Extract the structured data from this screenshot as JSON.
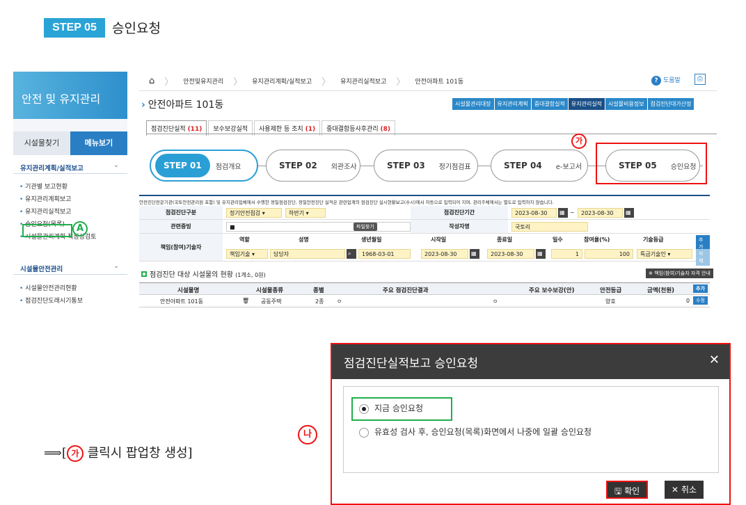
{
  "heading": {
    "step_badge": "STEP 05",
    "title": "승인요청"
  },
  "sidebar": {
    "title": "안전 및 유지관리",
    "tabs": [
      "시설물찾기",
      "메뉴보기"
    ],
    "section1": "유지관리계획/실적보고",
    "items1": [
      "기관별 보고현황",
      "유지관리계획보고",
      "유지관리실적보고",
      "승인요청(목록)",
      "시설물관리계획 적정성검토"
    ],
    "section2": "시설물안전관리",
    "items2": [
      "시설물안전관리현황",
      "점검진단도래시기통보"
    ],
    "marker": "A"
  },
  "breadcrumb": [
    "안전및유지관리",
    "유지관리계획/실적보고",
    "유지관리실적보고",
    "안전아파트 101동"
  ],
  "help_label": "도움말",
  "page_title": "안전아파트 101동",
  "topnav": [
    "시설물관리대장",
    "유지관리계획",
    "중대결함실적",
    "유지관리실적",
    "시설물비용정보",
    "점검진단대가산정"
  ],
  "subtabs": [
    {
      "label": "점검진단실적",
      "count": "(11)"
    },
    {
      "label": "보수보강실적",
      "count": ""
    },
    {
      "label": "사용제한 등 조치",
      "count": "(1)"
    },
    {
      "label": "중대결함등사후관리",
      "count": "(8)"
    }
  ],
  "steps": [
    {
      "id": "STEP 01",
      "name": "점검개요"
    },
    {
      "id": "STEP 02",
      "name": "외관조사"
    },
    {
      "id": "STEP 03",
      "name": "정기점검표"
    },
    {
      "id": "STEP 04",
      "name": "e-보고서"
    },
    {
      "id": "STEP 05",
      "name": "승인요청"
    }
  ],
  "marker_ga": "가",
  "marker_na": "나",
  "notice": "안전진단전문기관(국토안전관리원 포함) 및 유지관리업체에서 수행한 정밀점검진단, 정밀안전진단 실적은 관련업계의 점검진단 실시현황보고(수시)에서 자동으로 입력되어 지며, 관리주체에서는 별도로 입력하지 않습니다.",
  "form": {
    "type_label": "점검진단구분",
    "type_val": "정기안전점검",
    "half_val": "하반기",
    "period_label": "점검진단기간",
    "start": "2023-08-30",
    "end": "2023-08-30",
    "evidence_label": "관련증빙",
    "file_btn": "파일찾기",
    "writer_label": "작성자명",
    "writer": "국토리",
    "eng_label": "책임(참여)기술자",
    "eng_cols": [
      "역할",
      "성명",
      "생년월일",
      "시작일",
      "종료일",
      "일수",
      "참여율(%)",
      "기술등급"
    ],
    "eng_row": [
      "책임기술",
      "담당자",
      "1968-03-01",
      "2023-08-30",
      "2023-08-30",
      "1",
      "100",
      "특급기술인"
    ],
    "add": "추가",
    "del": "삭제"
  },
  "section2": {
    "title": "점검진단 대상 시설물의 현황",
    "sub": "(1개소, 0원)",
    "qual_btn": "※ 책임(참여)기술자 자격 안내"
  },
  "table": {
    "headers": [
      "시설물명",
      "시설물종류",
      "종별",
      "주요 점검진단결과",
      "주요 보수보강(안)",
      "안전등급",
      "금액(천원)"
    ],
    "row": [
      "안전아파트 101동",
      "공동주택",
      "2종",
      "ㅇ",
      "ㅇ",
      "양호",
      "0"
    ],
    "add": "추가",
    "edit": "수정"
  },
  "popup": {
    "title": "점검진단실적보고 승인요청",
    "options": [
      "지금 승인요청",
      "유효성 검사 후, 승인요청(목록)화면에서 나중에 일괄 승인요청"
    ],
    "ok": "확인",
    "cancel": "취소"
  },
  "note": {
    "arrow": "⟹",
    "open": "[",
    "ga": "가",
    "text": "클릭시 팝업창 생성]"
  }
}
